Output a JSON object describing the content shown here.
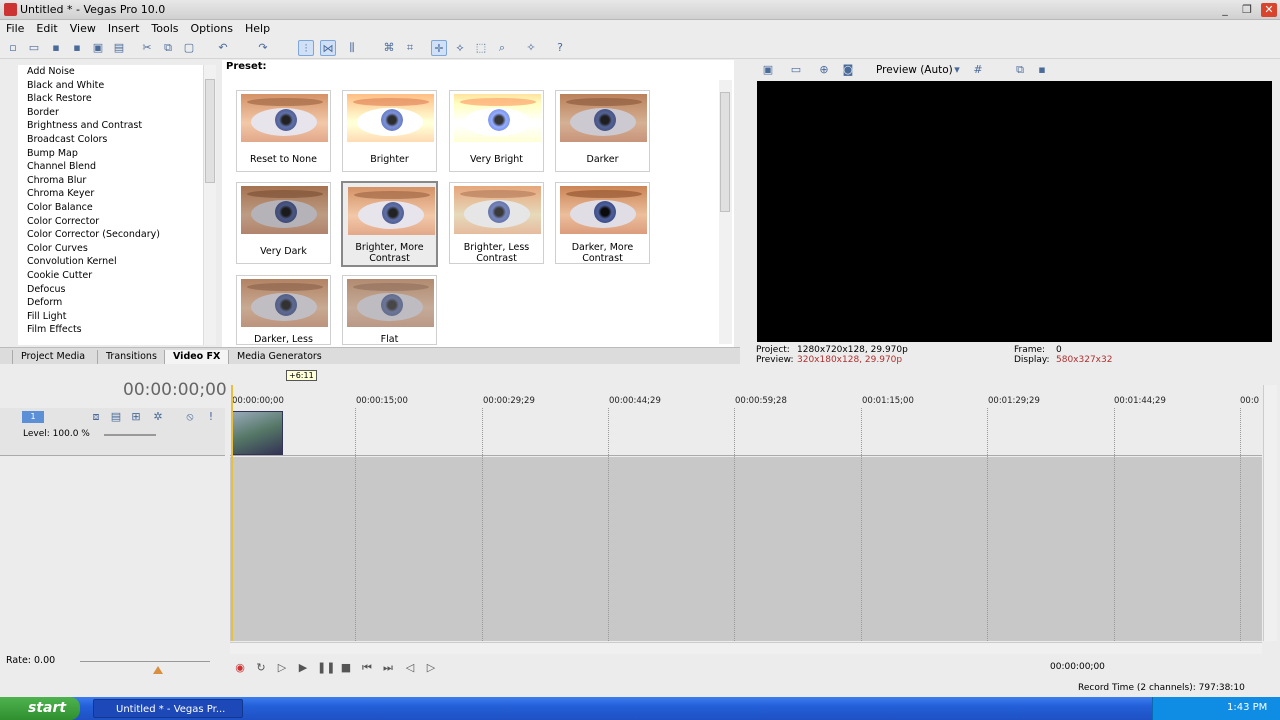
{
  "window": {
    "title": "Untitled * - Vegas Pro 10.0",
    "minimize_label": "_",
    "maximize_label": "❐",
    "close_label": "✕"
  },
  "menu": [
    "File",
    "Edit",
    "View",
    "Insert",
    "Tools",
    "Options",
    "Help"
  ],
  "fx_list": [
    "Add Noise",
    "Black and White",
    "Black Restore",
    "Border",
    "Brightness and Contrast",
    "Broadcast Colors",
    "Bump Map",
    "Channel Blend",
    "Chroma Blur",
    "Chroma Keyer",
    "Color Balance",
    "Color Corrector",
    "Color Corrector (Secondary)",
    "Color Curves",
    "Convolution Kernel",
    "Cookie Cutter",
    "Defocus",
    "Deform",
    "Fill Light",
    "Film Effects"
  ],
  "preset_label": "Preset:",
  "presets": [
    "Reset to None",
    "Brighter",
    "Very Bright",
    "Darker",
    "Very Dark",
    "Brighter, More Contrast",
    "Brighter, Less Contrast",
    "Darker, More Contrast",
    "Darker, Less",
    "Flat"
  ],
  "tabs": [
    "Project Media",
    "Transitions",
    "Video FX",
    "Media Generators"
  ],
  "preview": {
    "mode": "Preview (Auto)",
    "project_label": "Project:",
    "project_value": "1280x720x128, 29.970p",
    "preview_label": "Preview:",
    "preview_value": "320x180x128, 29.970p",
    "frame_label": "Frame:",
    "frame_value": "0",
    "display_label": "Display:",
    "display_value": "580x327x32"
  },
  "timeline": {
    "timecode": "00:00:00;00",
    "marker": "+6:11",
    "ruler": [
      "00:00:00;00",
      "00:00:15;00",
      "00:00:29;29",
      "00:00:44;29",
      "00:00:59;28",
      "00:01:15;00",
      "00:01:29;29",
      "00:01:44;29",
      "00:0"
    ],
    "track_number": "1",
    "level_label": "Level: 100.0 %",
    "rate_label": "Rate: 0.00",
    "end_timecode": "00:00:00;00",
    "record_time": "Record Time (2 channels): 797:38:10"
  },
  "taskbar": {
    "start": "start",
    "task": "Untitled * - Vegas Pr...",
    "clock": "1:43 PM"
  }
}
